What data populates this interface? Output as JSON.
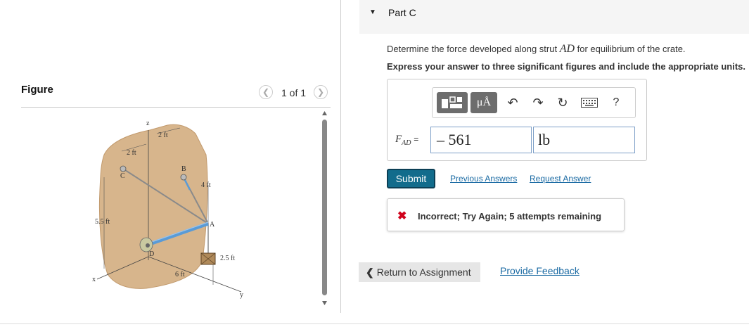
{
  "figure_panel": {
    "title": "Figure",
    "pager": {
      "text": "1 of 1",
      "prev_icon": "chevron-left-icon",
      "next_icon": "chevron-right-icon"
    },
    "diagram": {
      "labels": {
        "z": "z",
        "x": "x",
        "y": "y",
        "C": "C",
        "B": "B",
        "A": "A",
        "D": "D",
        "dim_2ft_top": "2 ft",
        "dim_2ft_left": "2 ft",
        "dim_4ft": "4 ft",
        "dim_5_5ft": "5.5 ft",
        "dim_2_5ft": "2.5 ft",
        "dim_6ft": "6 ft"
      },
      "colors": {
        "wall": "#d7b58c",
        "strut": "#5a9bd6",
        "cable": "#8a8a8a"
      }
    }
  },
  "part": {
    "toggle_icon": "caret-down-icon",
    "title": "Part C",
    "question_prefix": "Determine the force developed along strut ",
    "question_var": "AD",
    "question_suffix": " for equilibrium of the crate.",
    "instructions": "Express your answer to three significant figures and include the appropriate units."
  },
  "toolbar": {
    "templates_icon": "templates-icon",
    "units_label": "μÅ",
    "undo_icon": "undo-icon",
    "redo_icon": "redo-icon",
    "reset_icon": "reset-icon",
    "keyboard_icon": "keyboard-icon",
    "help_label": "?"
  },
  "answer": {
    "label_main": "F",
    "label_sub": "AD",
    "equals": "=",
    "value": "– 561",
    "unit": "lb"
  },
  "actions": {
    "submit": "Submit",
    "previous_answers": "Previous Answers",
    "request_answer": "Request Answer"
  },
  "feedback": {
    "icon": "x-icon",
    "text": "Incorrect; Try Again; 5 attempts remaining",
    "color": "#d0021b"
  },
  "footer": {
    "return_label": "Return to Assignment",
    "return_icon": "chevron-left-icon",
    "provide_feedback": "Provide Feedback"
  }
}
